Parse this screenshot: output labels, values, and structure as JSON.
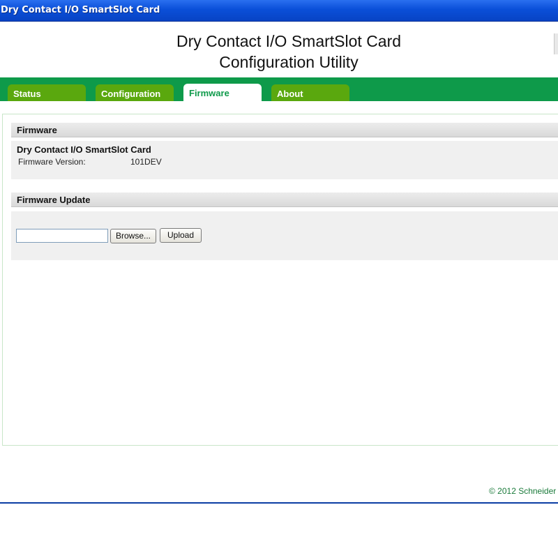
{
  "window": {
    "title": "Dry Contact I/O SmartSlot Card"
  },
  "header": {
    "line1": "Dry Contact I/O SmartSlot Card",
    "line2": "Configuration Utility"
  },
  "tabs": [
    {
      "label": "Status",
      "active": false
    },
    {
      "label": "Configuration",
      "active": false
    },
    {
      "label": "Firmware",
      "active": true
    },
    {
      "label": "About",
      "active": false
    }
  ],
  "firmware_section": {
    "title": "Firmware",
    "card_name": "Dry Contact I/O SmartSlot Card",
    "version_label": "Firmware Version:",
    "version_value": "101DEV"
  },
  "update_section": {
    "title": "Firmware Update",
    "file_value": "",
    "browse_label": "Browse...",
    "upload_label": "Upload"
  },
  "footer": {
    "text": "© 2012 Schneider"
  },
  "colors": {
    "tabbar": "#0e9a4a",
    "tab": "#5aa80e",
    "active_tab_text": "#0e9a4a",
    "titlebar": "#0a4fd8"
  }
}
